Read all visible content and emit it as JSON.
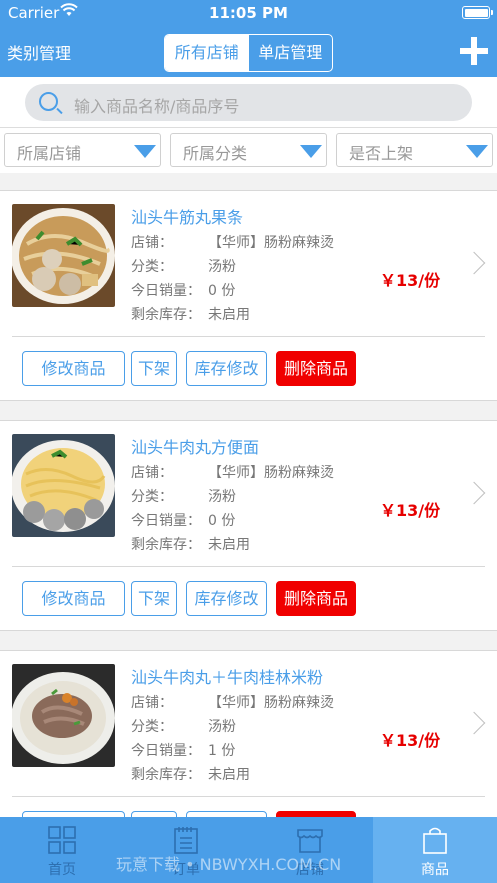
{
  "status": {
    "carrier": "Carrier",
    "time": "11:05 PM"
  },
  "nav": {
    "left_label": "类别管理",
    "segments": [
      "所有店铺",
      "单店管理"
    ]
  },
  "search": {
    "placeholder": "输入商品名称/商品序号"
  },
  "filters": [
    "所属店铺",
    "所属分类",
    "是否上架"
  ],
  "labels": {
    "shop": "店铺：",
    "category": "分类：",
    "sales": "今日销量：",
    "stock": "剩余库存："
  },
  "buttons": {
    "edit": "修改商品",
    "offshelf": "下架",
    "stock": "库存修改",
    "delete": "删除商品"
  },
  "products": [
    {
      "name": "汕头牛筋丸果条",
      "shop": "【华师】肠粉麻辣烫",
      "category": "汤粉",
      "sales": "0 份",
      "stock": "未启用",
      "price": "￥13/份"
    },
    {
      "name": "汕头牛肉丸方便面",
      "shop": "【华师】肠粉麻辣烫",
      "category": "汤粉",
      "sales": "0 份",
      "stock": "未启用",
      "price": "￥13/份"
    },
    {
      "name": "汕头牛肉丸＋牛肉桂林米粉",
      "shop": "【华师】肠粉麻辣烫",
      "category": "汤粉",
      "sales": "1 份",
      "stock": "未启用",
      "price": "￥13/份"
    }
  ],
  "tabs": [
    "首页",
    "订单",
    "店铺",
    "商品"
  ],
  "active_tab": "商品",
  "watermark": "玩意下载 • NBWYXH.COM.CN",
  "colors": {
    "primary": "#4a9ee8",
    "danger": "#f00000",
    "price": "#e60000"
  }
}
